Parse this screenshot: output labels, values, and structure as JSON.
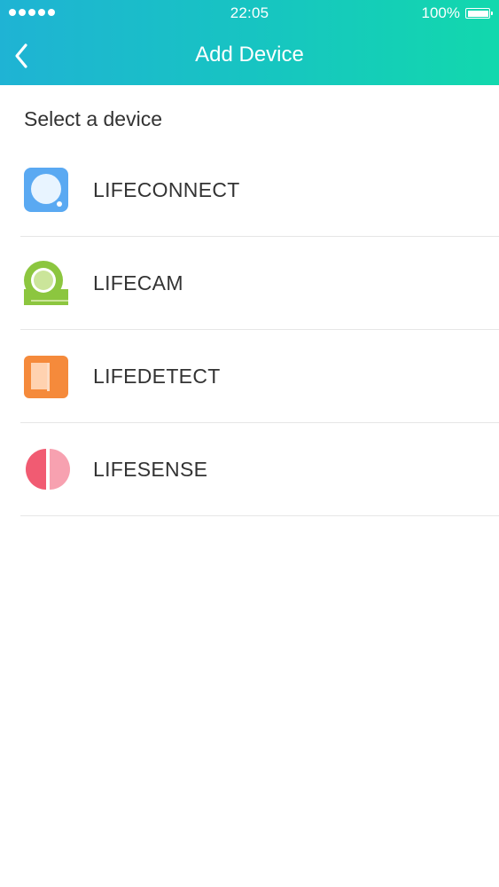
{
  "status_bar": {
    "time": "22:05",
    "battery": "100%",
    "icons": [
      "signal-dots-icon",
      "battery-icon"
    ]
  },
  "nav": {
    "title": "Add Device",
    "back_icon": "chevron-left-icon"
  },
  "section": {
    "title": "Select a device"
  },
  "devices": [
    {
      "label": "LIFECONNECT",
      "icon": "lifeconnect-icon",
      "color": "#5aa9f2"
    },
    {
      "label": "LIFECAM",
      "icon": "lifecam-icon",
      "color": "#8cc63f"
    },
    {
      "label": "LIFEDETECT",
      "icon": "lifedetect-icon",
      "color": "#f58a3b"
    },
    {
      "label": "LIFESENSE",
      "icon": "lifesense-icon",
      "color": "#f15b72"
    }
  ],
  "colors": {
    "header_gradient": [
      "#1fb3d4",
      "#12d8ad"
    ],
    "text": "#333333",
    "divider": "#e6e6e6"
  }
}
